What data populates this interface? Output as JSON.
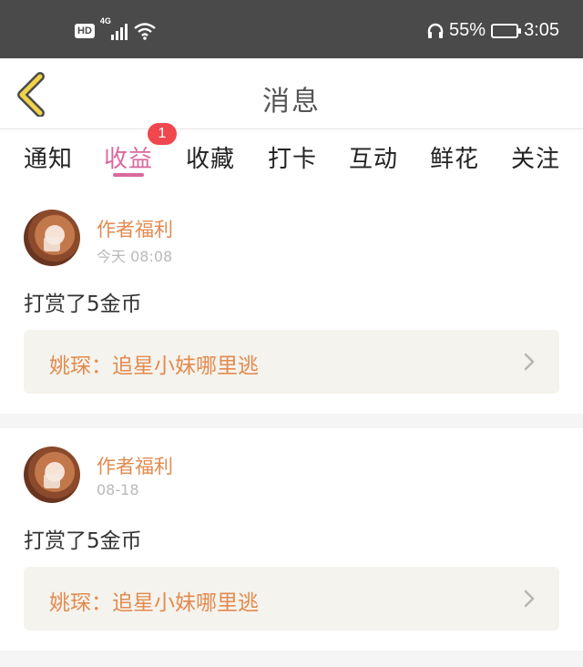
{
  "status_bar": {
    "hd": "HD",
    "network": "4G",
    "battery_text": "55%",
    "battery_level": 0.55,
    "time": "3:05",
    "icons": [
      "signal-icon",
      "wifi-icon",
      "headphones-icon",
      "battery-icon"
    ]
  },
  "header": {
    "title": "消息",
    "back_icon": "chevron-left-icon",
    "back_color": "#f0d34a"
  },
  "tabs": [
    {
      "label": "通知",
      "active": false
    },
    {
      "label": "收益",
      "active": true,
      "badge": "1"
    },
    {
      "label": "收藏",
      "active": false
    },
    {
      "label": "打卡",
      "active": false
    },
    {
      "label": "互动",
      "active": false
    },
    {
      "label": "鲜花",
      "active": false
    },
    {
      "label": "关注",
      "active": false
    }
  ],
  "messages": [
    {
      "author": "作者福利",
      "time": "今天 08:08",
      "content": "打赏了5金币",
      "book": "姚琛：追星小妹哪里逃"
    },
    {
      "author": "作者福利",
      "time": "08-18",
      "content": "打赏了5金币",
      "book": "姚琛：追星小妹哪里逃"
    }
  ],
  "colors": {
    "accent": "#d9699e",
    "badge": "#f0474e",
    "author": "#e28b50",
    "book_bg": "#f5f3ed"
  }
}
